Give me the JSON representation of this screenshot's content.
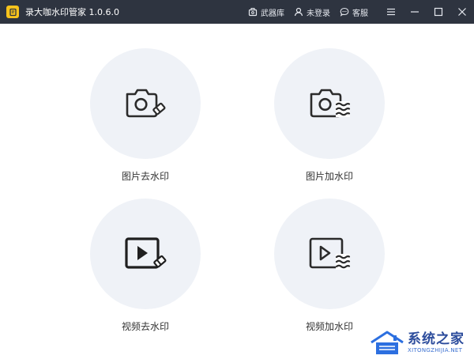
{
  "app": {
    "title": "录大咖水印管家  1.0.6.0",
    "logo_icon": "notebook-icon",
    "accent_color": "#f7c31c",
    "titlebar_color": "#2e3440"
  },
  "toolbar": {
    "links": [
      {
        "label": "武器库",
        "icon": "toolbox-icon"
      },
      {
        "label": "未登录",
        "icon": "user-icon"
      },
      {
        "label": "客服",
        "icon": "chat-bubble-icon"
      }
    ],
    "window_controls": [
      "menu-icon",
      "minimize-icon",
      "maximize-icon",
      "close-icon"
    ]
  },
  "tiles": [
    {
      "label": "图片去水印",
      "icon": "camera-eraser-icon"
    },
    {
      "label": "图片加水印",
      "icon": "camera-waves-icon"
    },
    {
      "label": "视频去水印",
      "icon": "video-eraser-icon"
    },
    {
      "label": "视频加水印",
      "icon": "video-waves-icon"
    }
  ],
  "watermark": {
    "name": "系统之家",
    "domain": "XITONGZHIJIA.NET"
  }
}
